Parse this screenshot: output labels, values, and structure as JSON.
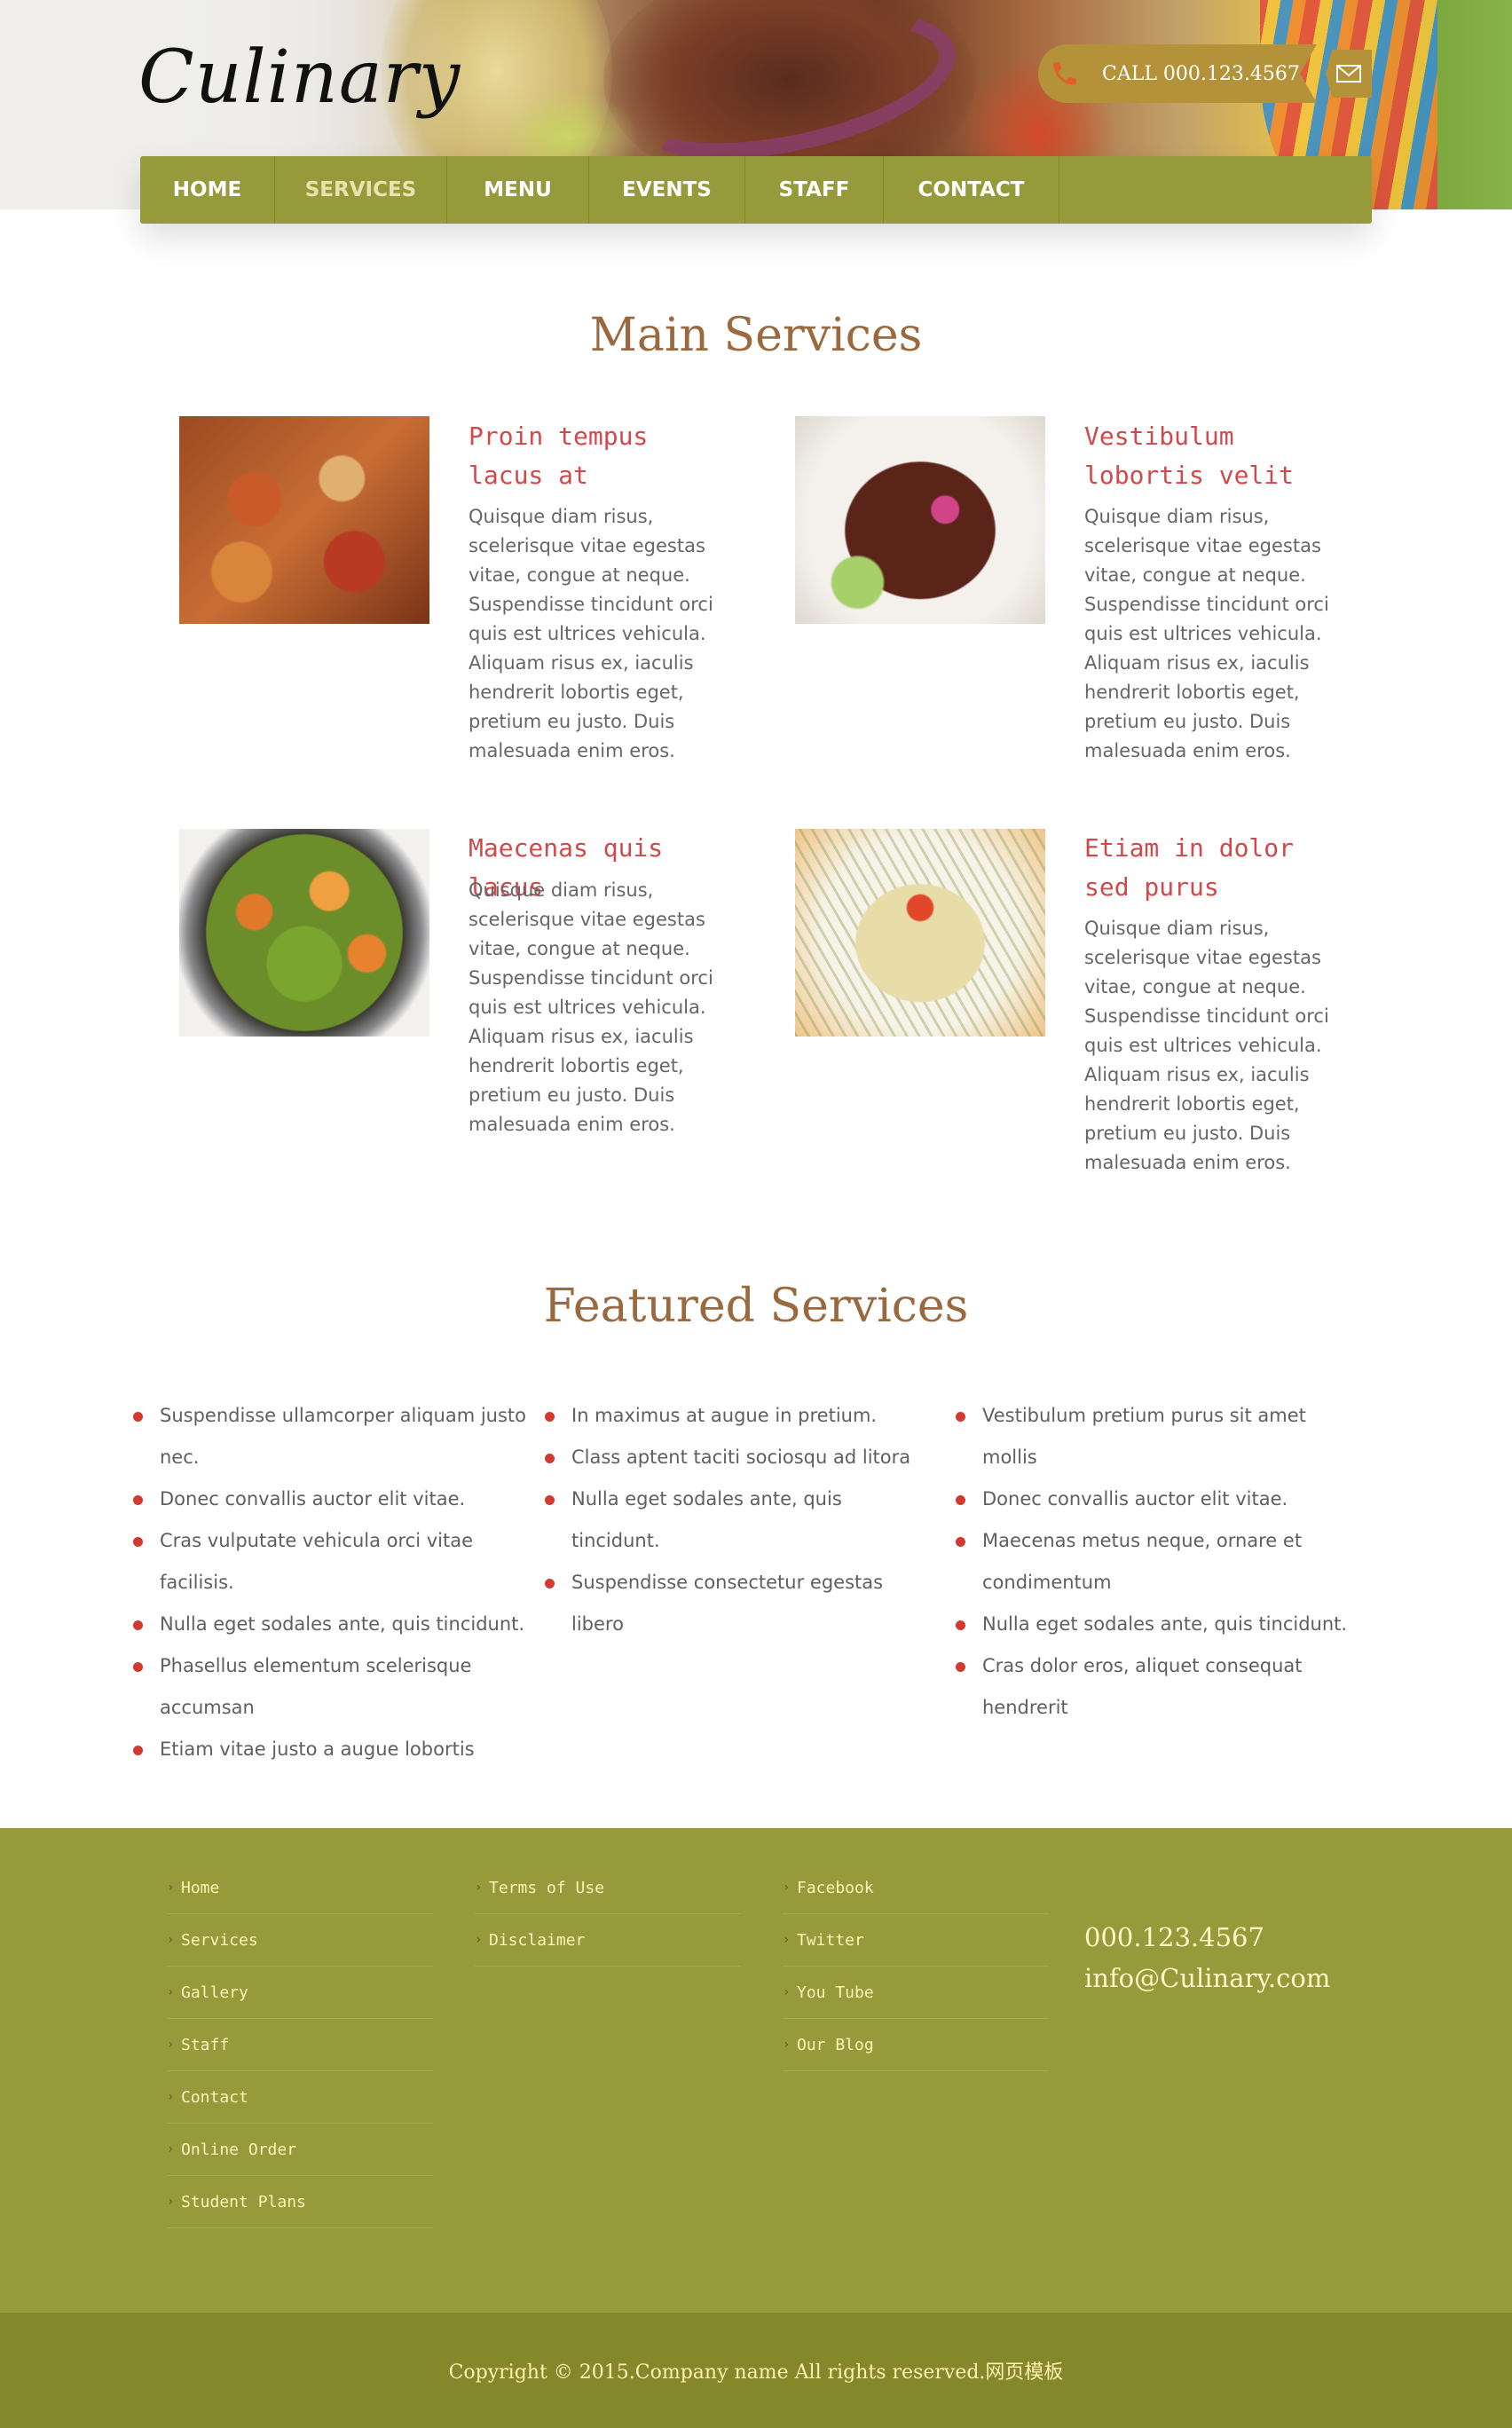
{
  "header": {
    "logo": "Culinary",
    "call": "CALL 000.123.4567",
    "phone_icon": "phone-icon",
    "mail_icon": "envelope-icon"
  },
  "nav": {
    "items": [
      {
        "label": "HOME",
        "active": false
      },
      {
        "label": "SERVICES",
        "active": true
      },
      {
        "label": "MENU",
        "active": false
      },
      {
        "label": "EVENTS",
        "active": false
      },
      {
        "label": "STAFF",
        "active": false
      },
      {
        "label": "CONTACT",
        "active": false
      }
    ]
  },
  "main_services": {
    "title": "Main Services",
    "items": [
      {
        "title": "Proin tempus lacus at",
        "text": "Quisque diam risus, scelerisque vitae egestas vitae, congue at neque. Suspendisse tincidunt orci quis est ultrices vehicula. Aliquam risus ex, iaculis hendrerit lobortis eget, pretium eu justo. Duis malesuada enim eros."
      },
      {
        "title": "Vestibulum lobortis velit",
        "text": "Quisque diam risus, scelerisque vitae egestas vitae, congue at neque. Suspendisse tincidunt orci quis est ultrices vehicula. Aliquam risus ex, iaculis hendrerit lobortis eget, pretium eu justo. Duis malesuada enim eros."
      },
      {
        "title": "Maecenas quis lacus",
        "text": "Quisque diam risus, scelerisque vitae egestas vitae, congue at neque. Suspendisse tincidunt orci quis est ultrices vehicula. Aliquam risus ex, iaculis hendrerit lobortis eget, pretium eu justo. Duis malesuada enim eros."
      },
      {
        "title": "Etiam in dolor sed purus",
        "text": "Quisque diam risus, scelerisque vitae egestas vitae, congue at neque. Suspendisse tincidunt orci quis est ultrices vehicula. Aliquam risus ex, iaculis hendrerit lobortis eget, pretium eu justo. Duis malesuada enim eros."
      }
    ]
  },
  "featured": {
    "title": "Featured Services",
    "columns": [
      [
        "Suspendisse ullamcorper aliquam justo nec.",
        "Donec convallis auctor elit vitae.",
        "Cras vulputate vehicula orci vitae facilisis.",
        "Nulla eget sodales ante, quis tincidunt.",
        "Phasellus elementum scelerisque accumsan",
        "Etiam vitae justo a augue lobortis"
      ],
      [
        "In maximus at augue in pretium.",
        "Class aptent taciti sociosqu ad litora",
        "Nulla eget sodales ante, quis tincidunt.",
        "Suspendisse consectetur egestas libero"
      ],
      [
        "Vestibulum pretium purus sit amet mollis",
        "Donec convallis auctor elit vitae.",
        "Maecenas metus neque, ornare et condimentum",
        "Nulla eget sodales ante, quis tincidunt.",
        "Cras dolor eros, aliquet consequat hendrerit"
      ]
    ]
  },
  "footer": {
    "col1": [
      "Home",
      "Services",
      "Gallery",
      "Staff",
      "Contact",
      "Online Order",
      "Student Plans"
    ],
    "col2": [
      "Terms of Use",
      "Disclaimer"
    ],
    "col3": [
      "Facebook",
      "Twitter",
      "You Tube",
      "Our Blog"
    ],
    "phone": "000.123.4567",
    "email": "info@Culinary.com",
    "copyright": "Copyright © 2015.Company name All rights reserved.网页模板"
  },
  "colors": {
    "nav_bg": "#979a3b",
    "accent_red": "#d1494a",
    "title_brown": "#9a6a3e",
    "footer_bg": "#979a3b",
    "copyright_bg": "#85882a",
    "footer_text": "#fff3b8"
  }
}
